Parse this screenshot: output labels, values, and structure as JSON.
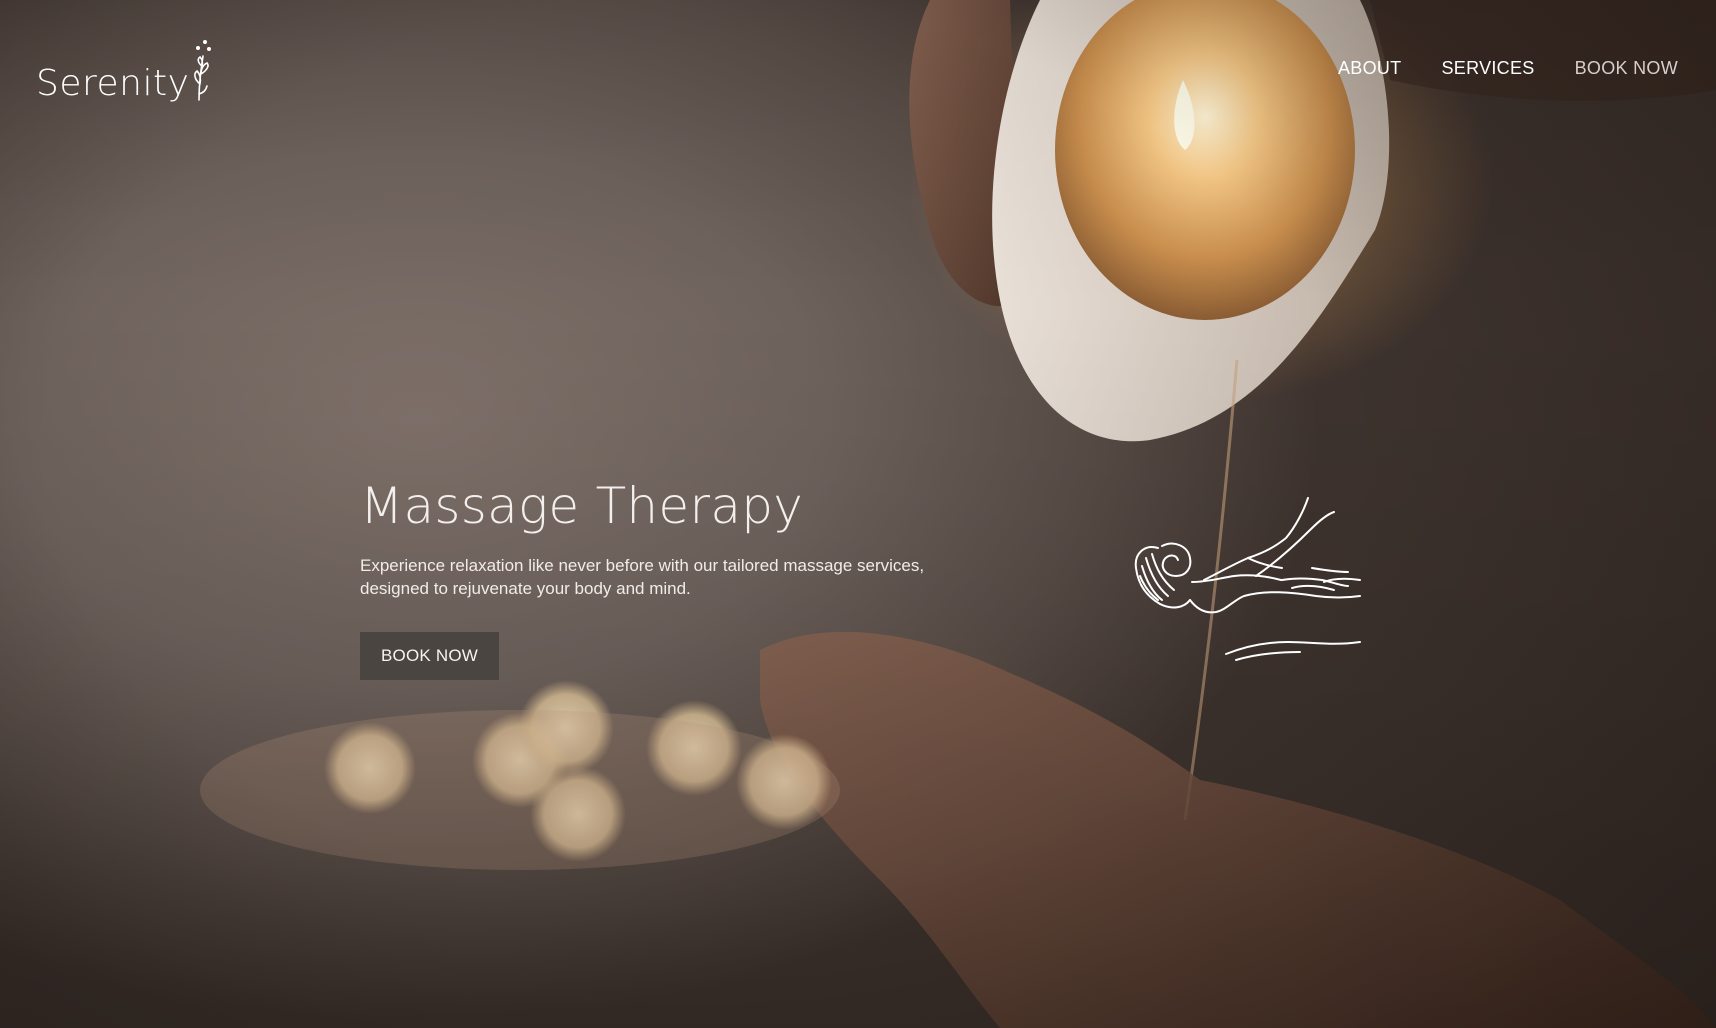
{
  "brand": {
    "name": "Serenity",
    "logo_icon": "sprig-icon"
  },
  "nav": {
    "items": [
      {
        "label": "ABOUT"
      },
      {
        "label": "SERVICES"
      },
      {
        "label": "BOOK NOW",
        "active": true
      }
    ]
  },
  "hero": {
    "title": "Massage Therapy",
    "text": "Experience relaxation like never before with our tailored massage services, designed to rejuvenate your body and mind.",
    "cta_label": "BOOK NOW",
    "illustration_icon": "massage-line-art-icon"
  },
  "colors": {
    "overlay": "#6e625c",
    "button": "#4b4541",
    "text": "#ffffff",
    "candle_glow": "#f0aa5a"
  }
}
